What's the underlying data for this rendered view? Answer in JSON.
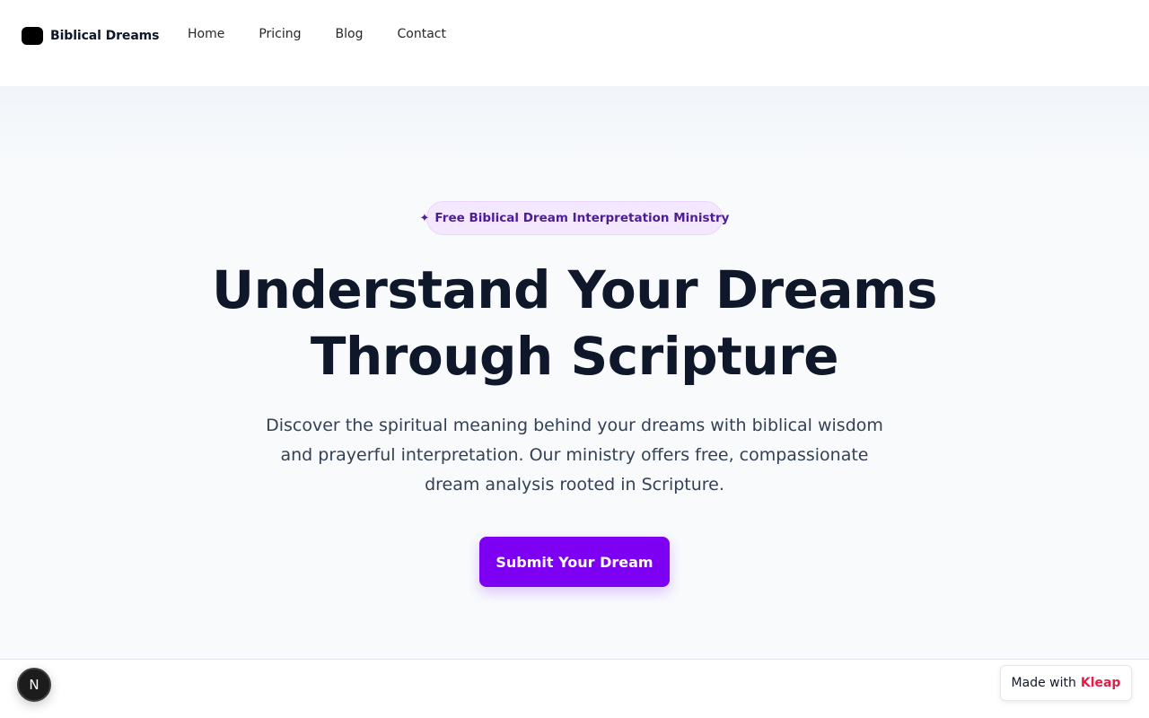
{
  "header": {
    "brand_name": "Biblical Dreams",
    "nav": [
      {
        "label": "Home"
      },
      {
        "label": "Pricing"
      },
      {
        "label": "Blog"
      },
      {
        "label": "Contact"
      }
    ]
  },
  "hero": {
    "badge_icon": "✦",
    "badge_text": "Free Biblical Dream Interpretation Ministry",
    "headline": "Understand Your Dreams Through Scripture",
    "subtext": "Discover the spiritual meaning behind your dreams with biblical wisdom and prayerful interpretation. Our ministry offers free, compassionate dream analysis rooted in Scripture.",
    "cta_label": "Submit Your Dream"
  },
  "footer": {
    "dev_badge_letter": "N",
    "made_with_prefix": "Made with",
    "made_with_brand": "Kleap"
  },
  "colors": {
    "accent": "#7e00f2",
    "badge_bg": "#f3e8ff",
    "badge_text": "#4c1d95",
    "kleap": "#e11d48"
  }
}
